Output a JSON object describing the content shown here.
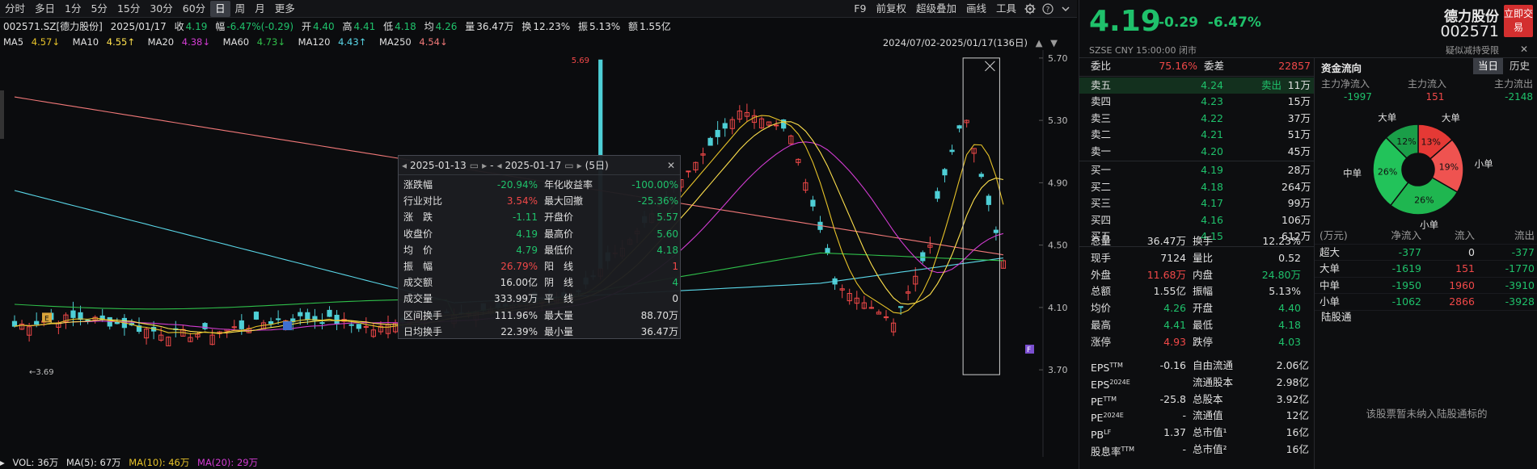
{
  "toolbar": {
    "periods": [
      "分时",
      "多日",
      "1分",
      "5分",
      "15分",
      "30分",
      "60分",
      "日",
      "周",
      "月",
      "更多"
    ],
    "active_period": "日",
    "right_items": [
      "F9",
      "前复权",
      "超级叠加",
      "画线",
      "工具"
    ]
  },
  "info": {
    "stock": "002571.SZ[德力股份]",
    "date": "2025/01/17",
    "close_label": "收",
    "close": "4.19",
    "chg_label": "幅",
    "chg": "-6.47%(-0.29)",
    "open_label": "开",
    "open": "4.40",
    "high_label": "高",
    "high": "4.41",
    "low_label": "低",
    "low": "4.18",
    "avg_label": "均",
    "avg": "4.26",
    "vol_label": "量",
    "vol": "36.47万",
    "turn_label": "换",
    "turn": "12.23%",
    "amp_label": "振",
    "amp": "5.13%",
    "amt_label": "额",
    "amt": "1.55亿",
    "range": "2024/07/02-2025/01/17(136日)"
  },
  "ma": [
    {
      "label": "MA5",
      "value": "4.57↓",
      "color": "#e6c229"
    },
    {
      "label": "MA10",
      "value": "4.55↑",
      "color": "#ffe14d"
    },
    {
      "label": "MA20",
      "value": "4.38↓",
      "color": "#d23cd2"
    },
    {
      "label": "MA60",
      "value": "4.73↓",
      "color": "#2fbf4a"
    },
    {
      "label": "MA120",
      "value": "4.43↑",
      "color": "#5ad7e8"
    },
    {
      "label": "MA250",
      "value": "4.54↓",
      "color": "#f07878"
    }
  ],
  "chart": {
    "price_axis": [
      "5.70",
      "5.30",
      "4.90",
      "4.50",
      "4.10",
      "3.70"
    ],
    "max_label": "5.69",
    "min_label": "3.69",
    "marker_e": "E",
    "marker_f": "F"
  },
  "volbar": {
    "vol": "VOL: 36万",
    "ma5": "MA(5): 67万",
    "ma10": "MA(10): 46万",
    "ma20": "MA(20): 29万"
  },
  "popup": {
    "start": "2025-01-13",
    "dash": "-",
    "end": "2025-01-17",
    "days": "(5日)",
    "rows": [
      [
        "涨跌幅",
        "-20.94%",
        "年化收益率",
        "-100.00%"
      ],
      [
        "行业对比",
        "3.54%",
        "最大回撤",
        "-25.36%"
      ],
      [
        "涨　跌",
        "-1.11",
        "开盘价",
        "5.57"
      ],
      [
        "收盘价",
        "4.19",
        "最高价",
        "5.60"
      ],
      [
        "均　价",
        "4.79",
        "最低价",
        "4.18"
      ],
      [
        "振　幅",
        "26.79%",
        "阳　线",
        "1"
      ],
      [
        "成交额",
        "16.00亿",
        "阴　线",
        "4"
      ],
      [
        "成交量",
        "333.99万",
        "平　线",
        "0"
      ],
      [
        "区间换手",
        "111.96%",
        "最大量",
        "88.70万"
      ],
      [
        "日均换手",
        "22.39%",
        "最小量",
        "36.47万"
      ]
    ]
  },
  "quote": {
    "price": "4.19",
    "chg": "-0.29",
    "pct": "-6.47%",
    "meta": "SZSE  CNY  15:00:00  闭市",
    "name": "德力股份",
    "code": "002571",
    "restrict": "疑似减持受限",
    "trade": "立即交易",
    "weibi_label": "委比",
    "weibi": "75.16%",
    "weicha_label": "委差",
    "weicha": "22857",
    "asks": [
      {
        "label": "卖五",
        "price": "4.24",
        "tag": "卖出",
        "vol": "11万"
      },
      {
        "label": "卖四",
        "price": "4.23",
        "tag": "",
        "vol": "15万"
      },
      {
        "label": "卖三",
        "price": "4.22",
        "tag": "",
        "vol": "37万"
      },
      {
        "label": "卖二",
        "price": "4.21",
        "tag": "",
        "vol": "51万"
      },
      {
        "label": "卖一",
        "price": "4.20",
        "tag": "",
        "vol": "45万"
      }
    ],
    "bids": [
      {
        "label": "买一",
        "price": "4.19",
        "vol": "28万"
      },
      {
        "label": "买二",
        "price": "4.18",
        "vol": "264万"
      },
      {
        "label": "买三",
        "price": "4.17",
        "vol": "99万"
      },
      {
        "label": "买四",
        "price": "4.16",
        "vol": "106万"
      },
      {
        "label": "买五",
        "price": "4.15",
        "vol": "612万"
      }
    ],
    "stats": [
      [
        "总量",
        "36.47万",
        "换手",
        "12.23%"
      ],
      [
        "现手",
        "7124",
        "量比",
        "0.52"
      ],
      [
        "外盘",
        "11.68万",
        "内盘",
        "24.80万"
      ],
      [
        "总额",
        "1.55亿",
        "振幅",
        "5.13%"
      ],
      [
        "均价",
        "4.26",
        "开盘",
        "4.40"
      ],
      [
        "最高",
        "4.41",
        "最低",
        "4.18"
      ],
      [
        "涨停",
        "4.93",
        "跌停",
        "4.03"
      ]
    ],
    "fin": [
      [
        "EPS",
        "TTM",
        "-0.16",
        "自由流通",
        "2.06亿"
      ],
      [
        "EPS",
        "2024E",
        "",
        "流通股本",
        "2.98亿"
      ],
      [
        "PE",
        "TTM",
        "-25.8",
        "总股本",
        "3.92亿"
      ],
      [
        "PE",
        "2024E",
        "-",
        "流通值",
        "12亿"
      ],
      [
        "PB",
        "LF",
        "1.37",
        "总市值¹",
        "16亿"
      ],
      [
        "股息率",
        "TTM",
        "-",
        "总市值²",
        "16亿"
      ]
    ]
  },
  "flow": {
    "title": "资金流向",
    "tab_today": "当日",
    "tab_history": "历史",
    "sum_labels": [
      "主力净流入",
      "主力流入",
      "主力流出"
    ],
    "sum_values": [
      "-1997",
      "151",
      "-2148"
    ],
    "pie": [
      {
        "label": "大单",
        "pct": "13%",
        "value": 13,
        "color": "#e53935"
      },
      {
        "label": "小单",
        "pct": "19%",
        "value": 19,
        "color": "#ef5350"
      },
      {
        "label": "小单",
        "pct": "26%",
        "value": 26,
        "color": "#1fb650"
      },
      {
        "label": "中单",
        "pct": "26%",
        "value": 26,
        "color": "#22c35a"
      },
      {
        "label": "大单",
        "pct": "12%",
        "value": 12,
        "color": "#1a9e48"
      }
    ],
    "table_header": [
      "(万元)",
      "净流入",
      "流入",
      "流出"
    ],
    "table": [
      [
        "超大",
        "-377",
        "0",
        "-377"
      ],
      [
        "大单",
        "-1619",
        "151",
        "-1770"
      ],
      [
        "中单",
        "-1950",
        "1960",
        "-3910"
      ],
      [
        "小单",
        "-1062",
        "2866",
        "-3928"
      ]
    ],
    "hk_title": "陆股通",
    "hk_note": "该股票暂未纳入陆股通标的"
  }
}
